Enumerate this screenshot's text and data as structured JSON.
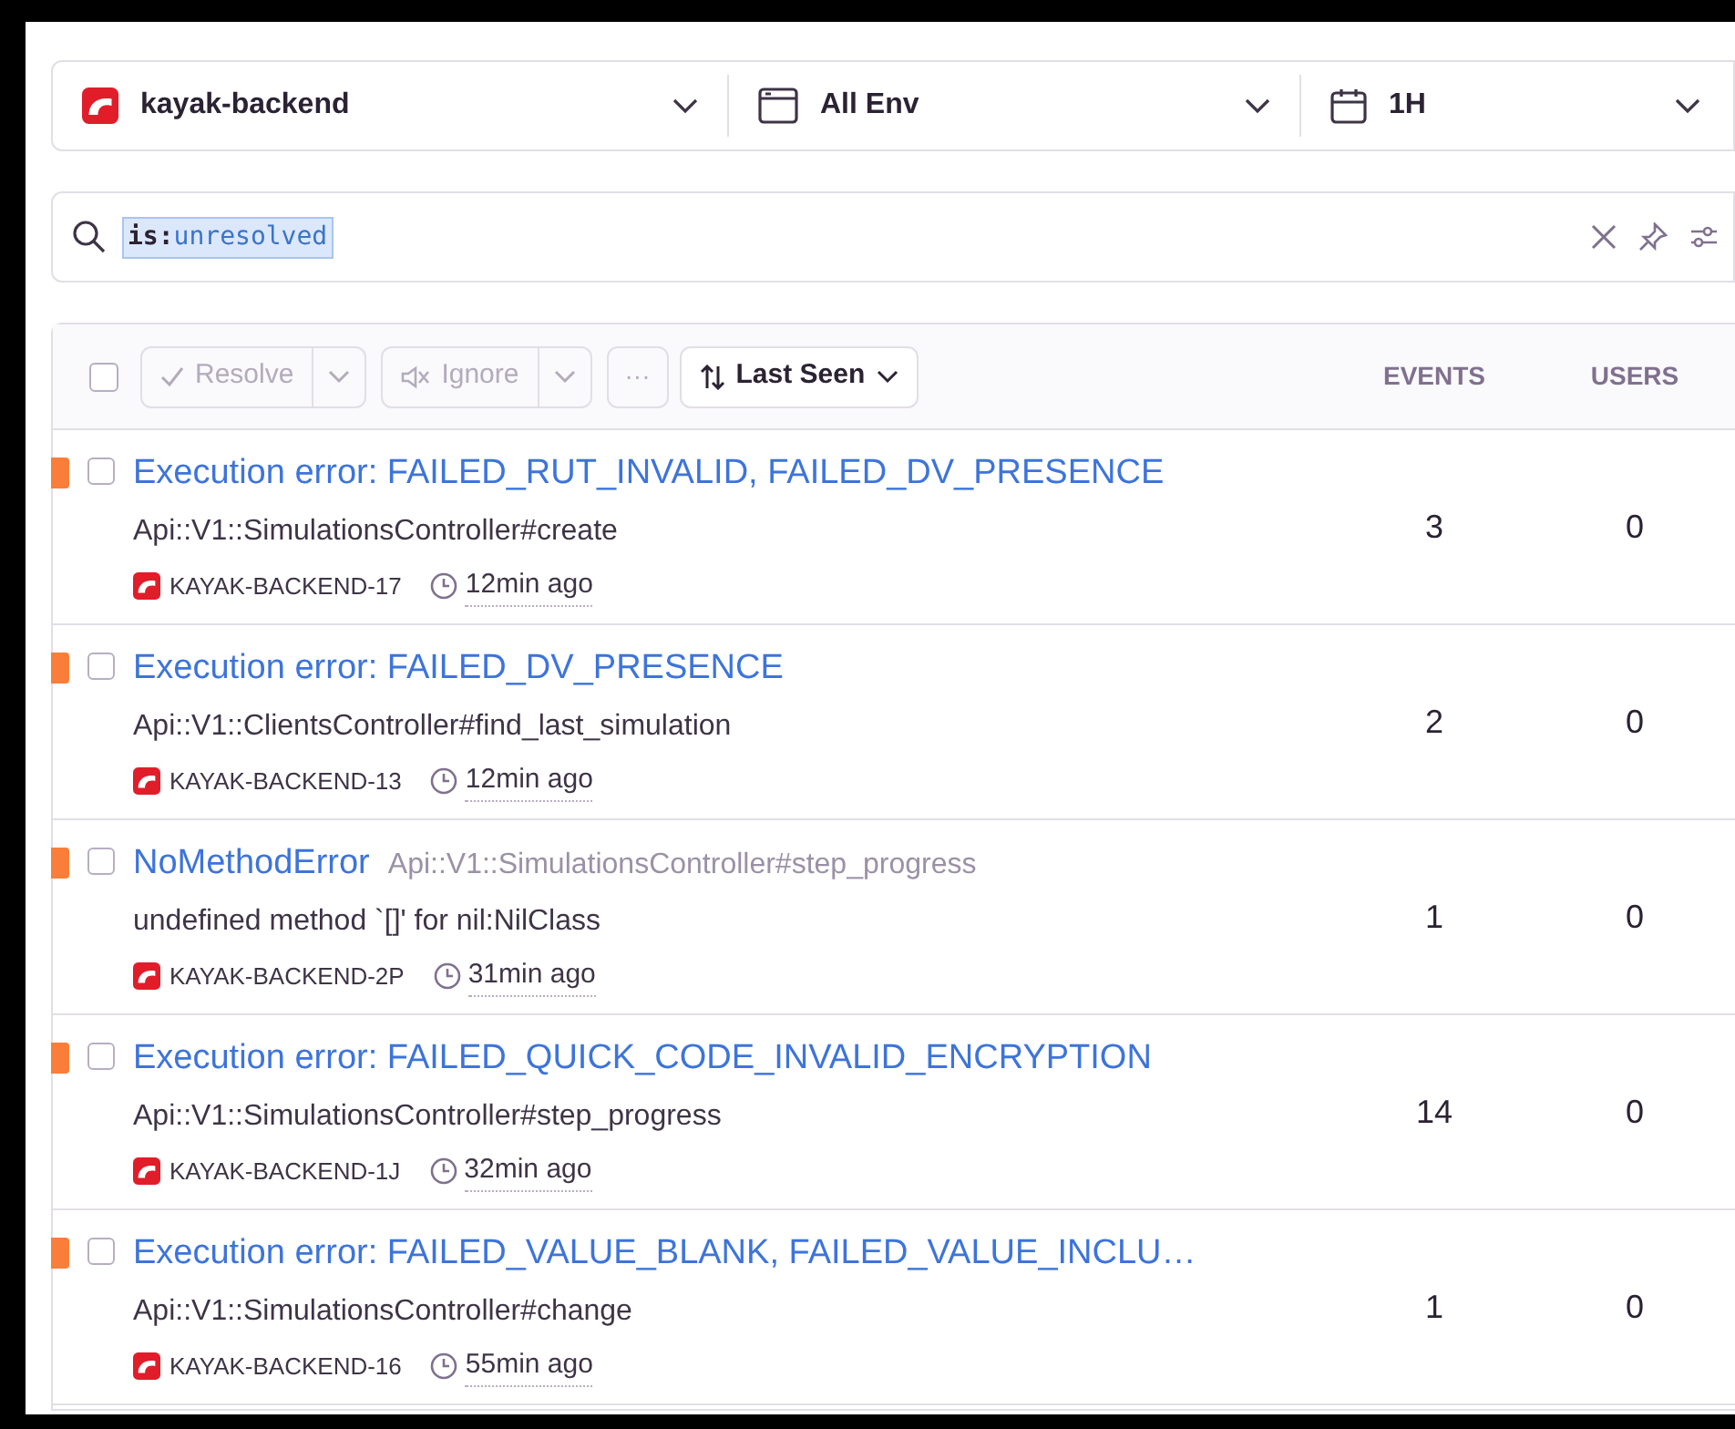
{
  "filters": [
    {
      "kind": "project",
      "label": "kayak-backend"
    },
    {
      "kind": "environment",
      "label": "All Env"
    },
    {
      "kind": "period",
      "label": "1H"
    }
  ],
  "search": {
    "token_key": "is:",
    "token_value": "unresolved"
  },
  "toolbar": {
    "select_all_checked": false,
    "resolve": "Resolve",
    "ignore": "Ignore",
    "more": "···",
    "sort": "Last Seen"
  },
  "columns": [
    "EVENTS",
    "USERS"
  ],
  "issues": [
    {
      "checked": false,
      "title": "Execution error: FAILED_RUT_INVALID, FAILED_DV_PRESENCE",
      "subtitle": "Api::V1::SimulationsController#create",
      "short_id": "KAYAK-BACKEND-17",
      "time": "12min ago",
      "events": "3",
      "users": "0"
    },
    {
      "checked": false,
      "title": "Execution error: FAILED_DV_PRESENCE",
      "subtitle": "Api::V1::ClientsController#find_last_simulation",
      "short_id": "KAYAK-BACKEND-13",
      "time": "12min ago",
      "events": "2",
      "users": "0"
    },
    {
      "checked": false,
      "title": "NoMethodError",
      "culprit": "Api::V1::SimulationsController#step_progress",
      "subtitle": "undefined method `[]' for nil:NilClass",
      "short_id": "KAYAK-BACKEND-2P",
      "time": "31min ago",
      "events": "1",
      "users": "0"
    },
    {
      "checked": false,
      "title": "Execution error: FAILED_QUICK_CODE_INVALID_ENCRYPTION",
      "subtitle": "Api::V1::SimulationsController#step_progress",
      "short_id": "KAYAK-BACKEND-1J",
      "time": "32min ago",
      "events": "14",
      "users": "0"
    },
    {
      "checked": false,
      "title": "Execution error: FAILED_VALUE_BLANK, FAILED_VALUE_INCLU…",
      "subtitle": "Api::V1::SimulationsController#change",
      "short_id": "KAYAK-BACKEND-16",
      "time": "55min ago",
      "events": "1",
      "users": "0"
    }
  ]
}
